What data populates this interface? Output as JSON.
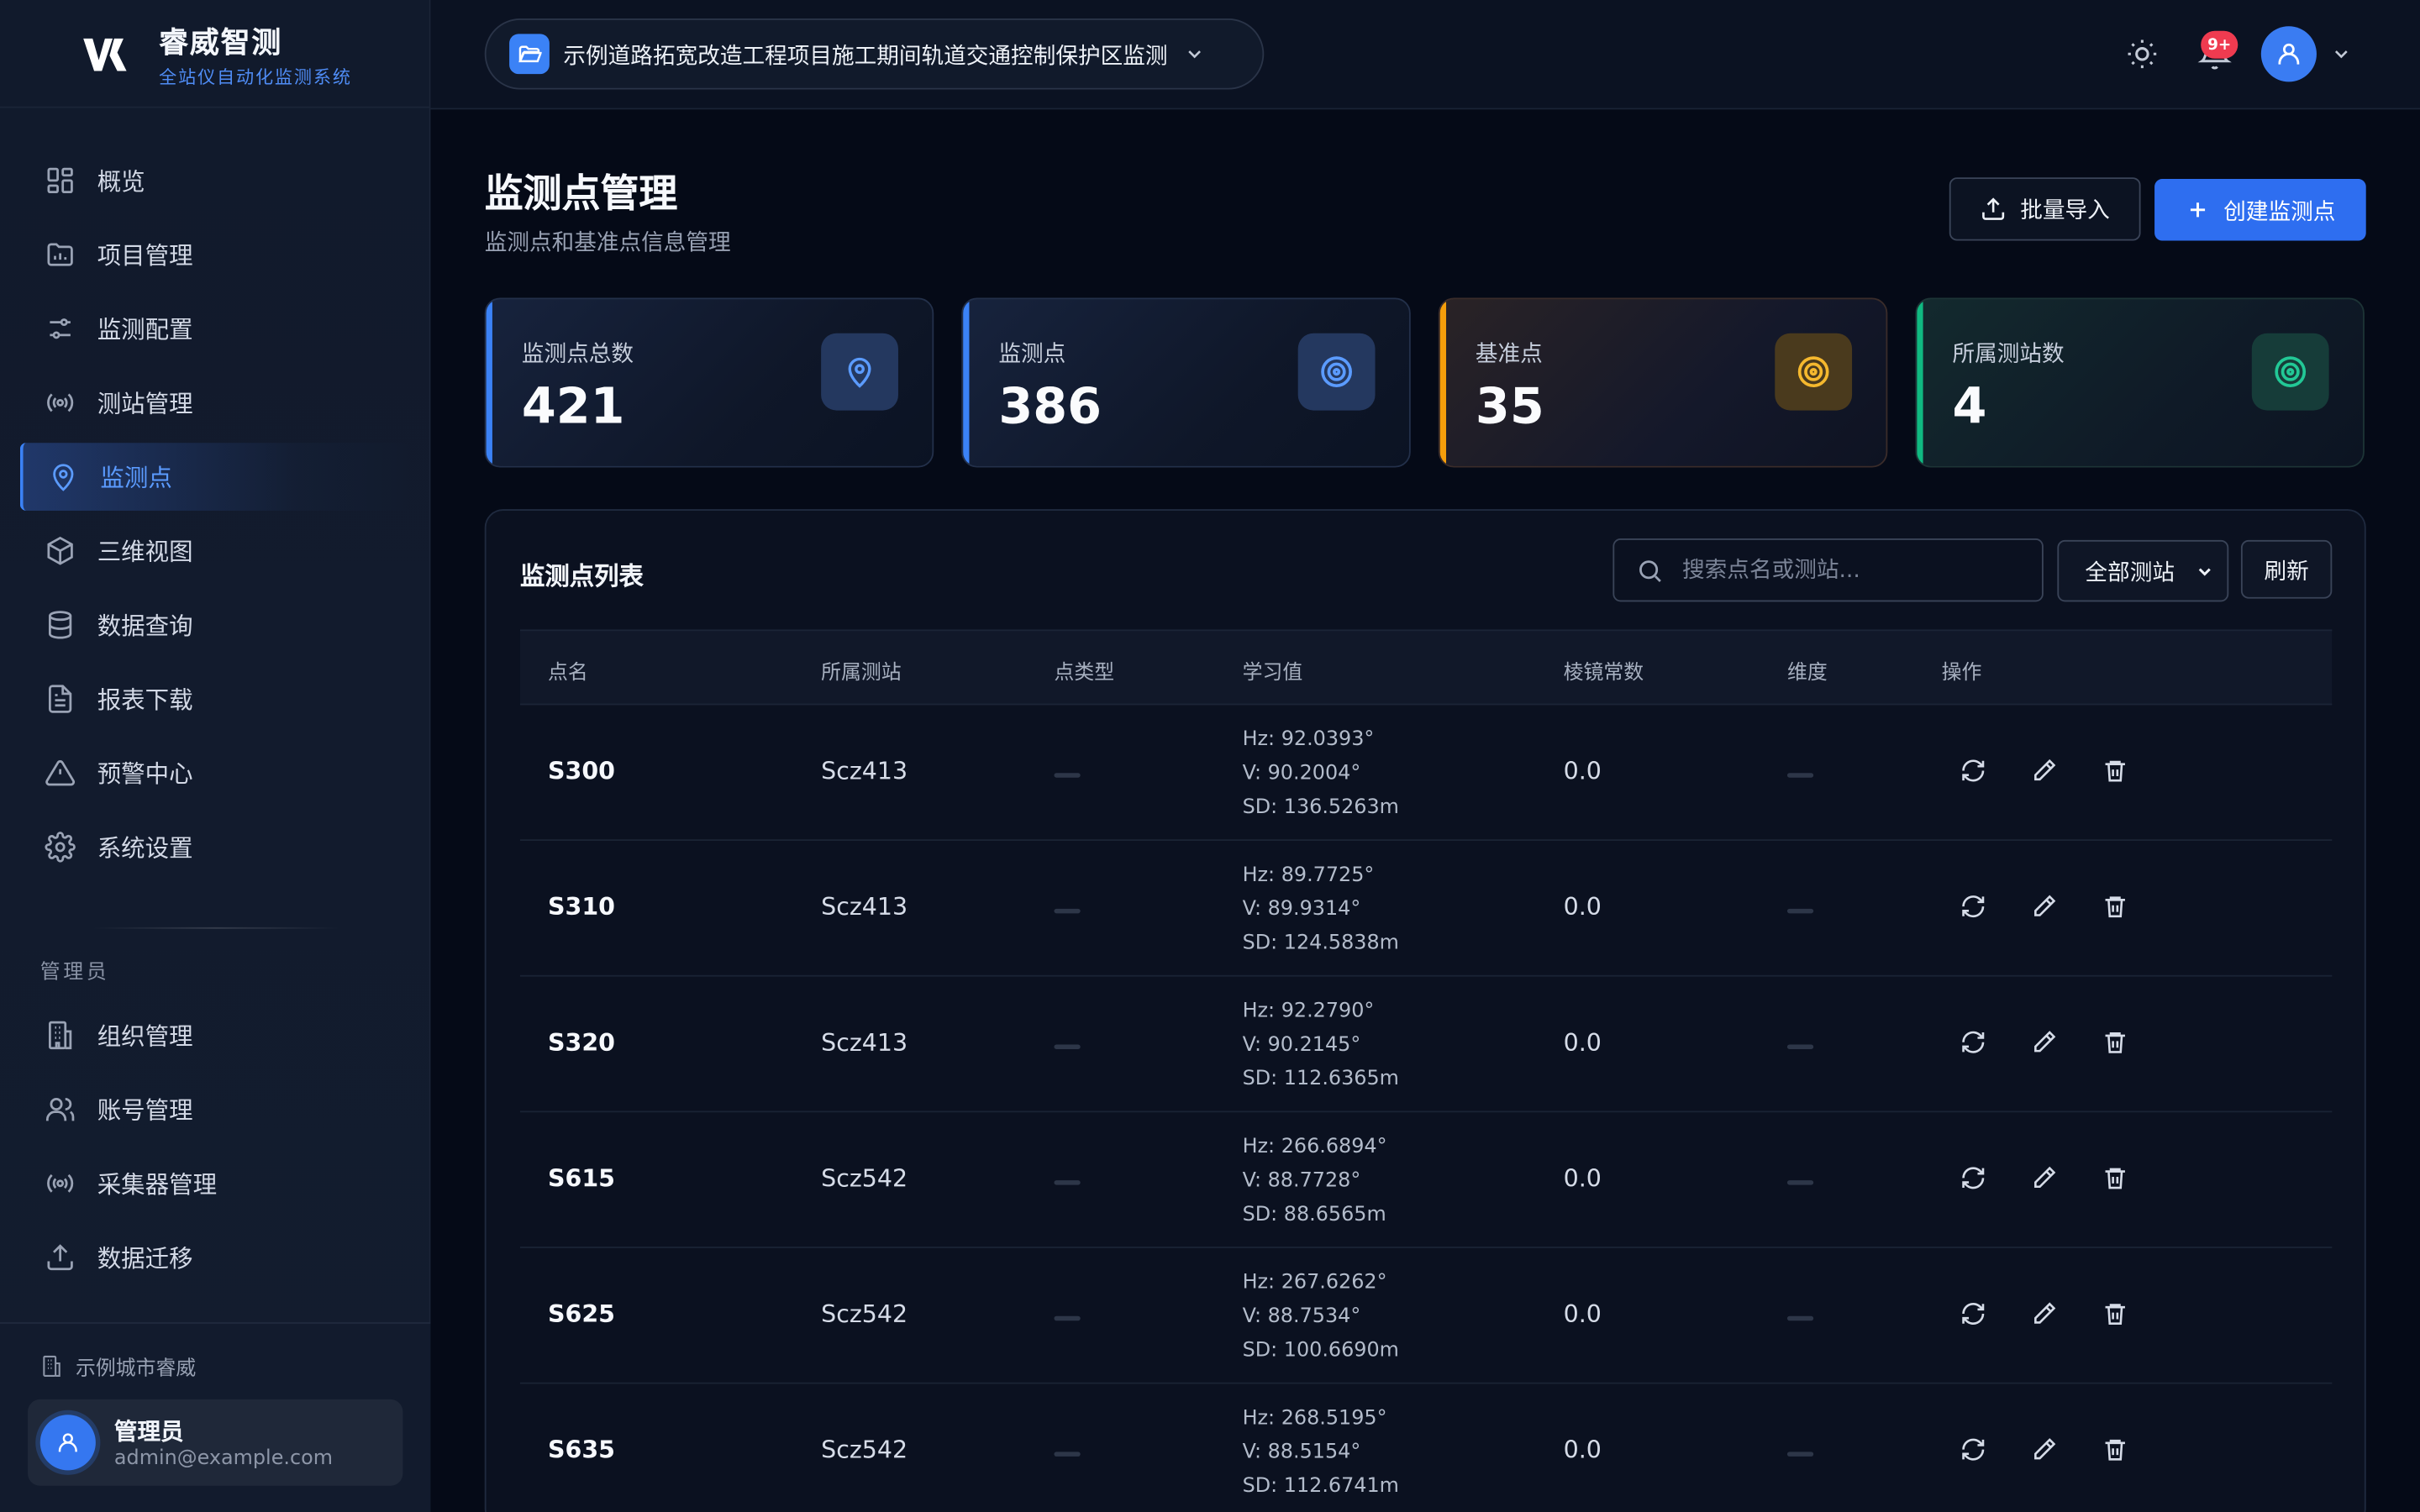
{
  "brand": {
    "title": "睿威智测",
    "subtitle": "全站仪自动化监测系统"
  },
  "nav": {
    "items": [
      {
        "label": "概览",
        "icon": "grid-icon",
        "active": false
      },
      {
        "label": "项目管理",
        "icon": "folder-chart-icon",
        "active": false
      },
      {
        "label": "监测配置",
        "icon": "sliders-icon",
        "active": false
      },
      {
        "label": "测站管理",
        "icon": "radio-icon",
        "active": false
      },
      {
        "label": "监测点",
        "icon": "map-pin-icon",
        "active": true
      },
      {
        "label": "三维视图",
        "icon": "cube-icon",
        "active": false
      },
      {
        "label": "数据查询",
        "icon": "database-icon",
        "active": false
      },
      {
        "label": "报表下载",
        "icon": "file-text-icon",
        "active": false
      },
      {
        "label": "预警中心",
        "icon": "alert-triangle-icon",
        "active": false
      },
      {
        "label": "系统设置",
        "icon": "gear-icon",
        "active": false
      }
    ],
    "section_label": "管理员",
    "admin_items": [
      {
        "label": "组织管理",
        "icon": "building-icon"
      },
      {
        "label": "账号管理",
        "icon": "users-icon"
      },
      {
        "label": "采集器管理",
        "icon": "radio-icon"
      },
      {
        "label": "数据迁移",
        "icon": "upload-icon"
      }
    ]
  },
  "footer": {
    "org": "示例城市睿威",
    "user_name": "管理员",
    "user_email": "admin@example.com"
  },
  "header": {
    "project": "示例道路拓宽改造工程项目施工期间轨道交通控制保护区监测",
    "notifications": "9+"
  },
  "page": {
    "title": "监测点管理",
    "subtitle": "监测点和基准点信息管理",
    "import_label": "批量导入",
    "create_label": "创建监测点"
  },
  "stats": [
    {
      "label": "监测点总数",
      "value": "421",
      "color": "#3b82f6",
      "icon": "map-pin-icon"
    },
    {
      "label": "监测点",
      "value": "386",
      "color": "#3b82f6",
      "icon": "target-icon"
    },
    {
      "label": "基准点",
      "value": "35",
      "color": "#f59e0b",
      "icon": "target-icon"
    },
    {
      "label": "所属测站数",
      "value": "4",
      "color": "#10b981",
      "icon": "target-icon"
    }
  ],
  "table": {
    "title": "监测点列表",
    "search_placeholder": "搜索点名或测站...",
    "station_filter": "全部测站",
    "refresh_label": "刷新",
    "columns": [
      "点名",
      "所属测站",
      "点类型",
      "学习值",
      "棱镜常数",
      "维度",
      "操作"
    ],
    "rows": [
      {
        "name": "S300",
        "station": "Scz413",
        "hz": "Hz: 92.0393°",
        "v": "V: 90.2004°",
        "sd": "SD: 136.5263m",
        "prism": "0.0"
      },
      {
        "name": "S310",
        "station": "Scz413",
        "hz": "Hz: 89.7725°",
        "v": "V: 89.9314°",
        "sd": "SD: 124.5838m",
        "prism": "0.0"
      },
      {
        "name": "S320",
        "station": "Scz413",
        "hz": "Hz: 92.2790°",
        "v": "V: 90.2145°",
        "sd": "SD: 112.6365m",
        "prism": "0.0"
      },
      {
        "name": "S615",
        "station": "Scz542",
        "hz": "Hz: 266.6894°",
        "v": "V: 88.7728°",
        "sd": "SD: 88.6565m",
        "prism": "0.0"
      },
      {
        "name": "S625",
        "station": "Scz542",
        "hz": "Hz: 267.6262°",
        "v": "V: 88.7534°",
        "sd": "SD: 100.6690m",
        "prism": "0.0"
      },
      {
        "name": "S635",
        "station": "Scz542",
        "hz": "Hz: 268.5195°",
        "v": "V: 88.5154°",
        "sd": "SD: 112.6741m",
        "prism": "0.0"
      }
    ]
  }
}
